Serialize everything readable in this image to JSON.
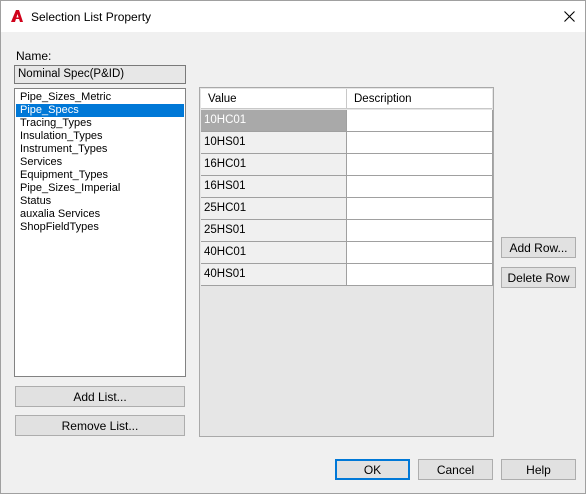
{
  "window": {
    "title": "Selection List Property"
  },
  "name": {
    "label": "Name:",
    "value": "Nominal Spec(P&ID)"
  },
  "lists": {
    "items": [
      "Pipe_Sizes_Metric",
      "Pipe_Specs",
      "Tracing_Types",
      "Insulation_Types",
      "Instrument_Types",
      "Services",
      "Equipment_Types",
      "Pipe_Sizes_Imperial",
      "Status",
      "auxalia Services",
      "ShopFieldTypes"
    ],
    "selected_index": 1,
    "add_label": "Add List...",
    "remove_label": "Remove List..."
  },
  "grid": {
    "columns": [
      "Value",
      "Description"
    ],
    "rows": [
      {
        "value": "10HC01",
        "description": ""
      },
      {
        "value": "10HS01",
        "description": ""
      },
      {
        "value": "16HC01",
        "description": ""
      },
      {
        "value": "16HS01",
        "description": ""
      },
      {
        "value": "25HC01",
        "description": ""
      },
      {
        "value": "25HS01",
        "description": ""
      },
      {
        "value": "40HC01",
        "description": ""
      },
      {
        "value": "40HS01",
        "description": ""
      }
    ],
    "selected_row": 0
  },
  "row_buttons": {
    "add_row": "Add Row...",
    "delete_row": "Delete Row"
  },
  "footer": {
    "ok": "OK",
    "cancel": "Cancel",
    "help": "Help"
  },
  "colors": {
    "accent": "#0078d7",
    "app_icon": "#d0021b"
  }
}
